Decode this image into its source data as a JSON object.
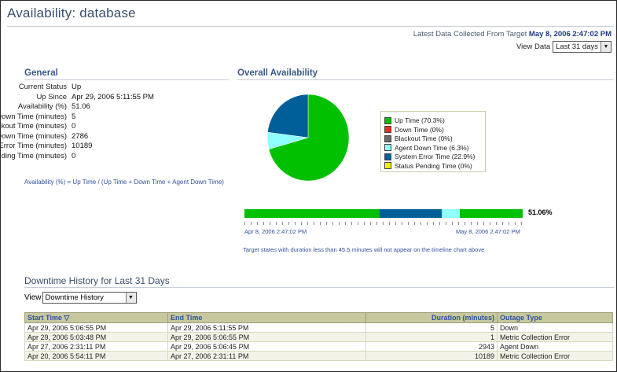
{
  "page": {
    "title": "Availability: database",
    "latest_label": "Latest Data Collected From Target",
    "latest_value": "May 8, 2006 2:47:02 PM",
    "view_data_label": "View Data",
    "view_data_value": "Last 31 days"
  },
  "general": {
    "heading": "General",
    "rows": [
      {
        "label": "Current Status",
        "value": "Up"
      },
      {
        "label": "Up Since",
        "value": "Apr 29, 2006 5:11:55 PM"
      },
      {
        "label": "Availability (%)",
        "value": "51.06"
      },
      {
        "label": "Down Time (minutes)",
        "value": "5"
      },
      {
        "label": "Blackout Time (minutes)",
        "value": "0"
      },
      {
        "label": "Agent Down Time (minutes)",
        "value": "2786"
      },
      {
        "label": "System Error Time (minutes)",
        "value": "10189"
      },
      {
        "label": "Status Pending Time (minutes)",
        "value": "0"
      }
    ],
    "link": "Availability (%) = Up Time / (Up Time + Down Time + Agent Down Time)"
  },
  "overall": {
    "heading": "Overall Availability",
    "slices": [
      {
        "name": "Up Time (70.3%)",
        "fraction": 0.703,
        "color": "#00c000"
      },
      {
        "name": "Down Time (0%)",
        "fraction": 0.0,
        "color": "#e03020"
      },
      {
        "name": "Blackout Time (0%)",
        "fraction": 0.0,
        "color": "#6a6a6a"
      },
      {
        "name": "Agent Down Time (6.3%)",
        "fraction": 0.063,
        "color": "#90ffff"
      },
      {
        "name": "System Error Time (22.9%)",
        "fraction": 0.229,
        "color": "#005f99"
      },
      {
        "name": "Status Pending Time (0%)",
        "fraction": 0.0,
        "color": "#f0f000"
      }
    ],
    "bar_pct": "51.06%",
    "bar_segments": [
      {
        "fraction": 0.485,
        "color": "#00c000"
      },
      {
        "fraction": 0.225,
        "color": "#005f99"
      },
      {
        "fraction": 0.065,
        "color": "#90ffff"
      },
      {
        "fraction": 0.225,
        "color": "#00c000"
      }
    ],
    "bar_start": "Apr 8, 2006 2:47:02 PM",
    "bar_end": "May 8, 2006 2:47:02 PM",
    "note": "Target states with duration less than 45.5 minutes will not appear on the timeline chart above"
  },
  "history": {
    "heading": "Downtime History for Last 31 Days",
    "view_label": "View",
    "view_value": "Downtime History",
    "columns": [
      "Start Time ▽",
      "End Time",
      "Duration (minutes)",
      "Outage Type"
    ],
    "rows": [
      [
        "Apr 29, 2006 5:06:55 PM",
        "Apr 29, 2006 5:11:55 PM",
        "5",
        "Down"
      ],
      [
        "Apr 29, 2006 5:03:48 PM",
        "Apr 29, 2006 5:06:55 PM",
        "1",
        "Metric Collection Error"
      ],
      [
        "Apr 27, 2006 2:31:11 PM",
        "Apr 29, 2006 5:06:45 PM",
        "2943",
        "Agent Down"
      ],
      [
        "Apr 20, 2006 5:54:11 PM",
        "Apr 27, 2006 2:31:11 PM",
        "10189",
        "Metric Collection Error"
      ]
    ]
  }
}
